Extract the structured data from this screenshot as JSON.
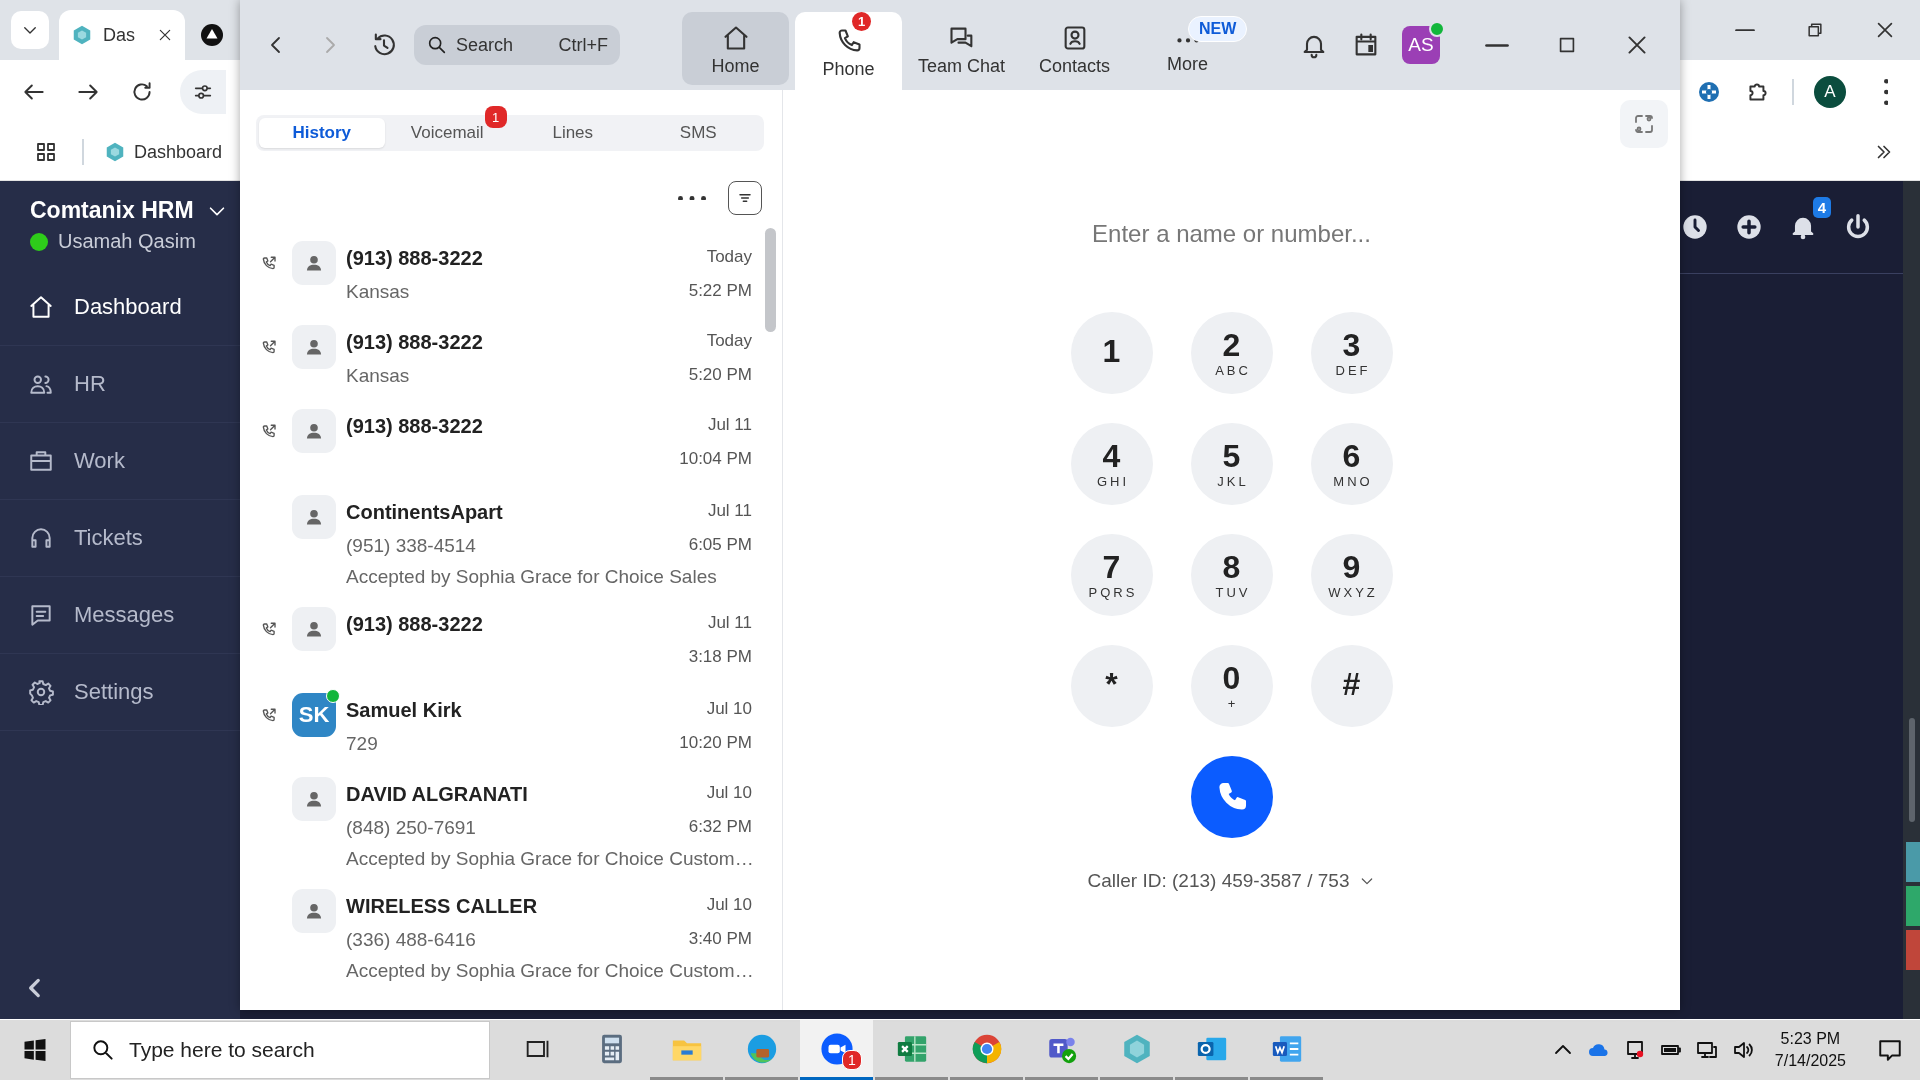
{
  "browser": {
    "tab": {
      "title": "Das"
    },
    "bookmark": "Dashboard",
    "profile_initial": "A"
  },
  "hrm": {
    "org": "Comtanix HRM",
    "user": "Usamah Qasim",
    "online": true,
    "nav": [
      {
        "label": "Dashboard",
        "selected": true
      },
      {
        "label": "HR",
        "selected": false
      },
      {
        "label": "Work",
        "selected": false
      },
      {
        "label": "Tickets",
        "selected": false
      },
      {
        "label": "Messages",
        "selected": false
      },
      {
        "label": "Settings",
        "selected": false
      }
    ],
    "notification_count": "4"
  },
  "zoom": {
    "search": {
      "placeholder": "Search",
      "shortcut": "Ctrl+F"
    },
    "nav": [
      {
        "label": "Home",
        "selected": false,
        "hovered": true
      },
      {
        "label": "Phone",
        "selected": true,
        "hovered": false,
        "badge": "1"
      },
      {
        "label": "Team Chat",
        "selected": false,
        "hovered": false
      },
      {
        "label": "Contacts",
        "selected": false,
        "hovered": false
      },
      {
        "label": "More",
        "selected": false,
        "hovered": false,
        "tag": "NEW"
      }
    ],
    "avatar": {
      "initials": "AS",
      "online": true
    },
    "phone_tabs": [
      {
        "label": "History",
        "selected": true
      },
      {
        "label": "Voicemail",
        "selected": false,
        "badge": "1"
      },
      {
        "label": "Lines",
        "selected": false
      },
      {
        "label": "SMS",
        "selected": false
      }
    ],
    "history": [
      {
        "name": "(913) 888-3222",
        "detail": "Kansas",
        "date": "Today",
        "time": "5:22 PM",
        "call_icon": true,
        "avatar": {
          "kind": "generic"
        }
      },
      {
        "name": "(913) 888-3222",
        "detail": "Kansas",
        "date": "Today",
        "time": "5:20 PM",
        "call_icon": true,
        "avatar": {
          "kind": "generic"
        }
      },
      {
        "name": "(913) 888-3222",
        "date": "Jul 11",
        "time": "10:04 PM",
        "call_icon": true,
        "avatar": {
          "kind": "generic"
        }
      },
      {
        "name": "ContinentsApart",
        "detail": "(951) 338-4514",
        "note": "Accepted by Sophia Grace for Choice Sales",
        "date": "Jul 11",
        "time": "6:05 PM",
        "call_icon": false,
        "avatar": {
          "kind": "generic"
        }
      },
      {
        "name": "(913) 888-3222",
        "date": "Jul 11",
        "time": "3:18 PM",
        "call_icon": true,
        "avatar": {
          "kind": "generic"
        }
      },
      {
        "name": "Samuel Kirk",
        "detail": "729",
        "date": "Jul 10",
        "time": "10:20 PM",
        "call_icon": true,
        "avatar": {
          "kind": "initials",
          "initials": "SK",
          "online": true
        }
      },
      {
        "name": "DAVID ALGRANATI",
        "detail": "(848) 250-7691",
        "note": "Accepted by Sophia Grace for Choice Custom…",
        "date": "Jul 10",
        "time": "6:32 PM",
        "call_icon": false,
        "avatar": {
          "kind": "generic"
        }
      },
      {
        "name": "WIRELESS CALLER",
        "detail": "(336) 488-6416",
        "note": "Accepted by Sophia Grace for Choice Custom…",
        "date": "Jul 10",
        "time": "3:40 PM",
        "call_icon": false,
        "avatar": {
          "kind": "generic"
        }
      }
    ],
    "dialer": {
      "placeholder": "Enter a name or number...",
      "keys": [
        {
          "digit": "1"
        },
        {
          "digit": "2",
          "letters": "ABC"
        },
        {
          "digit": "3",
          "letters": "DEF"
        },
        {
          "digit": "4",
          "letters": "GHI"
        },
        {
          "digit": "5",
          "letters": "JKL"
        },
        {
          "digit": "6",
          "letters": "MNO"
        },
        {
          "digit": "7",
          "letters": "PQRS"
        },
        {
          "digit": "8",
          "letters": "TUV"
        },
        {
          "digit": "9",
          "letters": "WXYZ"
        },
        {
          "digit": "*"
        },
        {
          "digit": "0",
          "letters": "+"
        },
        {
          "digit": "#"
        }
      ],
      "caller_id": "Caller ID: (213) 459-3587 / 753"
    }
  },
  "taskbar": {
    "search_placeholder": "Type here to search",
    "apps": [
      {
        "running": false,
        "active": false
      },
      {
        "running": false,
        "active": false
      },
      {
        "running": true,
        "active": false
      },
      {
        "running": true,
        "active": false
      },
      {
        "running": true,
        "active": true,
        "badge": "1"
      },
      {
        "running": true,
        "active": false
      },
      {
        "running": true,
        "active": false
      },
      {
        "running": true,
        "active": false
      },
      {
        "running": true,
        "active": false
      },
      {
        "running": true,
        "active": false
      },
      {
        "running": true,
        "active": false
      }
    ],
    "time": "5:23 PM",
    "date": "7/14/2025"
  }
}
